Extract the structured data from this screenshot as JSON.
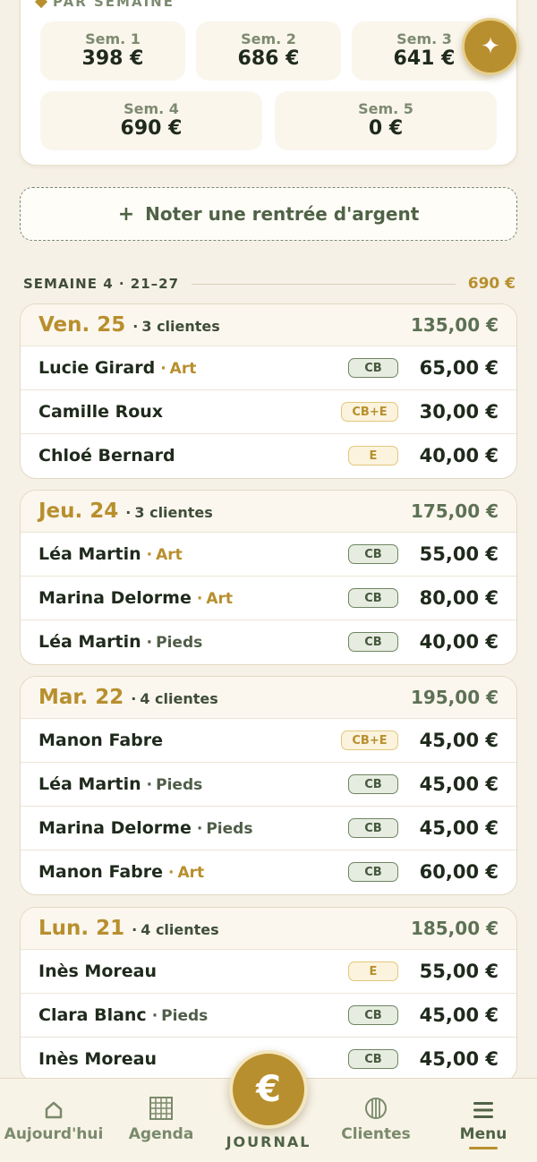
{
  "weekly": {
    "heading": "PAR SEMAINE",
    "weeks": [
      {
        "label": "Sem. 1",
        "amount": "398 €"
      },
      {
        "label": "Sem. 2",
        "amount": "686 €"
      },
      {
        "label": "Sem. 3",
        "amount": "641 €"
      },
      {
        "label": "Sem. 4",
        "amount": "690 €"
      },
      {
        "label": "Sem. 5",
        "amount": "0 €"
      }
    ]
  },
  "fab": {
    "icon": "sparkle-icon",
    "glyph": "✦"
  },
  "add_income": {
    "plus": "+",
    "label": "Noter une rentrée d'argent"
  },
  "week_section": {
    "label": "SEMAINE 4 · 21–27",
    "total": "690 €"
  },
  "days": [
    {
      "date": "Ven. 25",
      "sep": "·",
      "count": "3 clientes",
      "total": "135,00 €",
      "entries": [
        {
          "name": "Lucie Girard",
          "sep": "·",
          "service": "Art",
          "payment": "CB",
          "amount": "65,00 €"
        },
        {
          "name": "Camille Roux",
          "sep": "",
          "service": "",
          "payment": "CB+E",
          "amount": "30,00 €"
        },
        {
          "name": "Chloé Bernard",
          "sep": "",
          "service": "",
          "payment": "E",
          "amount": "40,00 €"
        }
      ]
    },
    {
      "date": "Jeu. 24",
      "sep": "·",
      "count": "3 clientes",
      "total": "175,00 €",
      "entries": [
        {
          "name": "Léa Martin",
          "sep": "·",
          "service": "Art",
          "payment": "CB",
          "amount": "55,00 €"
        },
        {
          "name": "Marina Delorme",
          "sep": "·",
          "service": "Art",
          "payment": "CB",
          "amount": "80,00 €"
        },
        {
          "name": "Léa Martin",
          "sep": "·",
          "service": "Pieds",
          "payment": "CB",
          "amount": "40,00 €"
        }
      ]
    },
    {
      "date": "Mar. 22",
      "sep": "·",
      "count": "4 clientes",
      "total": "195,00 €",
      "entries": [
        {
          "name": "Manon Fabre",
          "sep": "",
          "service": "",
          "payment": "CB+E",
          "amount": "45,00 €"
        },
        {
          "name": "Léa Martin",
          "sep": "·",
          "service": "Pieds",
          "payment": "CB",
          "amount": "45,00 €"
        },
        {
          "name": "Marina Delorme",
          "sep": "·",
          "service": "Pieds",
          "payment": "CB",
          "amount": "45,00 €"
        },
        {
          "name": "Manon Fabre",
          "sep": "·",
          "service": "Art",
          "payment": "CB",
          "amount": "60,00 €"
        }
      ]
    },
    {
      "date": "Lun. 21",
      "sep": "·",
      "count": "4 clientes",
      "total": "185,00 €",
      "entries": [
        {
          "name": "Inès Moreau",
          "sep": "",
          "service": "",
          "payment": "E",
          "amount": "55,00 €"
        },
        {
          "name": "Clara Blanc",
          "sep": "·",
          "service": "Pieds",
          "payment": "CB",
          "amount": "45,00 €"
        },
        {
          "name": "Inès Moreau",
          "sep": "",
          "service": "",
          "payment": "CB",
          "amount": "45,00 €"
        }
      ]
    }
  ],
  "nav": {
    "items": [
      {
        "label": "Aujourd'hui",
        "icon": "home-icon"
      },
      {
        "label": "Agenda",
        "icon": "calendar-grid-icon"
      },
      {
        "label": "Clientes",
        "icon": "clients-icon"
      },
      {
        "label": "Menu",
        "icon": "menu-icon"
      }
    ],
    "journal": {
      "glyph": "€",
      "label": "JOURNAL",
      "icon": "euro-icon"
    }
  },
  "colors": {
    "accent_gold": "#b88f2e",
    "green": "#4f6246",
    "background": "#f6f1e6",
    "card": "#ffffff"
  }
}
